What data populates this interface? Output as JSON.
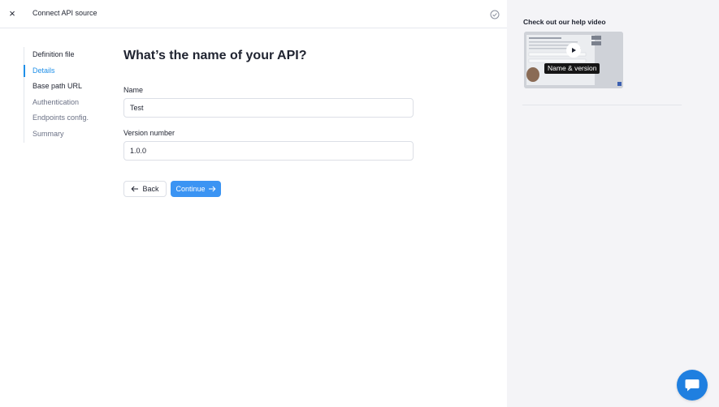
{
  "topbar": {
    "close_glyph": "×",
    "title": "Connect API source",
    "status_icon": "check-circle-icon"
  },
  "steps": [
    {
      "label": "Definition file",
      "state": "done"
    },
    {
      "label": "Details",
      "state": "active"
    },
    {
      "label": "Base path URL",
      "state": "done"
    },
    {
      "label": "Authentication",
      "state": "pending"
    },
    {
      "label": "Endpoints config.",
      "state": "pending"
    },
    {
      "label": "Summary",
      "state": "pending"
    }
  ],
  "form": {
    "heading": "What’s the name of your API?",
    "name_label": "Name",
    "name_value": "Test",
    "version_label": "Version number",
    "version_value": "1.0.0",
    "back_label": "Back",
    "continue_label": "Continue"
  },
  "help": {
    "title": "Check out our help video",
    "video_caption": "Name & version"
  },
  "colors": {
    "accent": "#1f8fe8",
    "primary_button": "#3b94f3",
    "chat_button": "#1f7fe0",
    "side_background": "#f4f4f7"
  }
}
